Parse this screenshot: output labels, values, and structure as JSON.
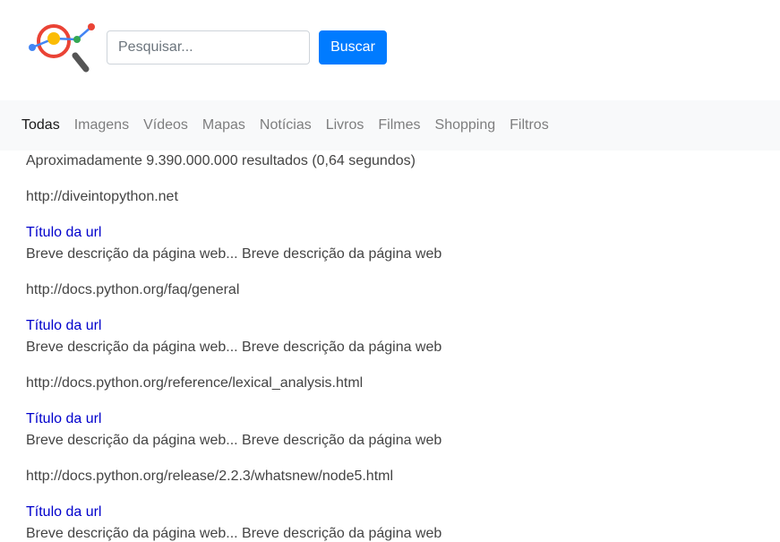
{
  "header": {
    "logo": {
      "icon": "analytics-magnifier-logo",
      "colors": {
        "blue": "#4285f4",
        "yellow": "#fbbc05",
        "green": "#34a853",
        "red": "#ea4335",
        "handle": "#555555"
      }
    },
    "search": {
      "placeholder": "Pesquisar...",
      "value": ""
    },
    "search_button_label": "Buscar"
  },
  "nav": {
    "items": [
      {
        "label": "Todas",
        "active": true
      },
      {
        "label": "Imagens"
      },
      {
        "label": "Vídeos"
      },
      {
        "label": "Mapas"
      },
      {
        "label": "Notícias"
      },
      {
        "label": "Livros"
      },
      {
        "label": "Filmes"
      },
      {
        "label": "Shopping"
      },
      {
        "label": "Filtros"
      }
    ]
  },
  "results": {
    "stats": "Aproximadamente 9.390.000.000 resultados (0,64 segundos)",
    "items": [
      {
        "url": "http://diveintopython.net",
        "title": "Título da url",
        "description": "Breve descrição da página web... Breve descrição da página web"
      },
      {
        "url": "http://docs.python.org/faq/general",
        "title": "Título da url",
        "description": "Breve descrição da página web... Breve descrição da página web"
      },
      {
        "url": "http://docs.python.org/reference/lexical_analysis.html",
        "title": "Título da url",
        "description": "Breve descrição da página web... Breve descrição da página web"
      },
      {
        "url": "http://docs.python.org/release/2.2.3/whatsnew/node5.html",
        "title": "Título da url",
        "description": "Breve descrição da página web... Breve descrição da página web"
      }
    ]
  },
  "colors": {
    "primary": "#007bff",
    "link": "#0000cc",
    "navbar_bg": "#f8f9fa",
    "text": "#444444"
  }
}
